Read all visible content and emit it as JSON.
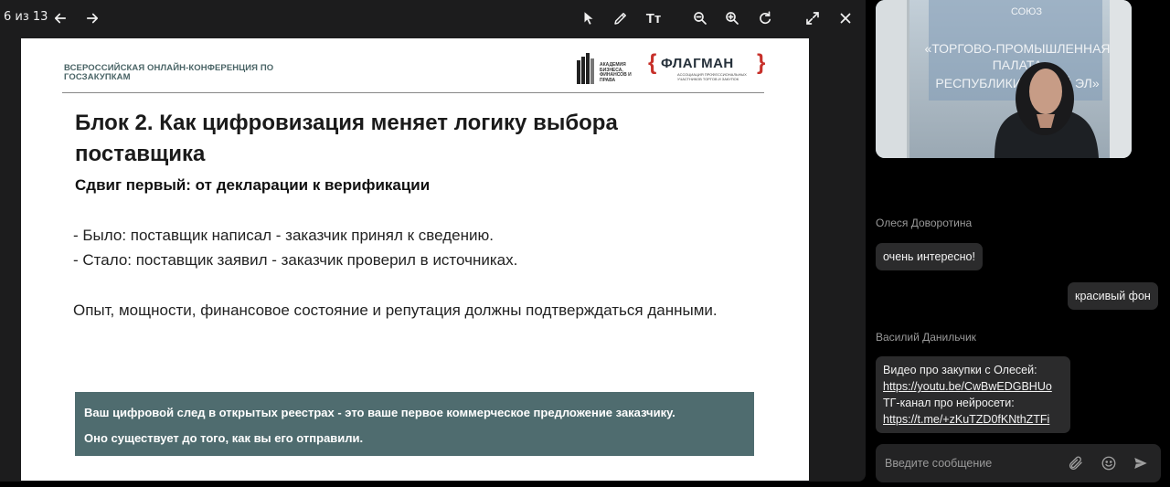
{
  "viewer": {
    "page_counter": "6 из 13",
    "toolbar_icons": [
      "arrow-left-icon",
      "arrow-right-icon",
      "pointer-icon",
      "pen-icon",
      "text-size-icon",
      "zoom-out-icon",
      "zoom-in-icon",
      "rotate-icon",
      "fullscreen-icon",
      "close-icon"
    ],
    "text_tool_label": "Tт"
  },
  "slide": {
    "conference_title": "ВСЕРОССИЙСКАЯ ОНЛАЙН-КОНФЕРЕНЦИЯ ПО ГОСЗАКУПКАМ",
    "logo_academy": "АКАДЕМИЯ БИЗНЕСА, ФИНАНСОВ И ПРАВА",
    "logo_flagman": "ФЛАГМАН",
    "logo_flagman_sub": "АССОЦИАЦИЯ ПРОФЕССИОНАЛЬНЫХ УЧАСТНИКОВ ТОРГОВ И ЗАКУПОК",
    "heading": "Блок 2. Как цифровизация меняет логику выбора поставщика",
    "subheading": "Сдвиг первый: от декларации к верификации",
    "was": "- Было: поставщик написал - заказчик принял к сведению.",
    "now": "- Стало: поставщик заявил - заказчик проверил в источниках.",
    "paragraph": " Опыт, мощности, финансовое состояние и репутация должны подтверждаться данными.",
    "callout_line1": "Ваш цифровой след в открытых реестрах - это ваше первое коммерческое предложение заказчику.",
    "callout_line2": "Оно существует до того, как вы его отправили."
  },
  "video": {
    "sign_line1": "СОЮЗ",
    "sign_line2": "«ТОРГОВО-ПРОМЫШЛЕННАЯ",
    "sign_line3": "ПАЛАТА",
    "sign_line4": "РЕСПУБЛИКИ МАРИЙ ЭЛ»"
  },
  "chat": {
    "author1": "Олеся Доворотина",
    "msg1": "очень интересно!",
    "msg2": "красивый фон",
    "author2": "Василий Данильчик",
    "msg3_line1": "Видео про закупки с Олесей:",
    "msg3_link1": "https://youtu.be/CwBwEDGBHUo",
    "msg3_line2": "ТГ-канал про нейросети:",
    "msg3_link2": "https://t.me/+zKuTZD0fKNthZTFi"
  },
  "input": {
    "placeholder": "Введите сообщение",
    "icons": [
      "paperclip-icon",
      "emoji-icon",
      "send-icon"
    ]
  },
  "colors": {
    "viewer_bg": "#1c1c1d",
    "callout_bg": "#4f6c6f",
    "flagman_red": "#c7302a",
    "bubble_bg": "#2b2b2c"
  }
}
